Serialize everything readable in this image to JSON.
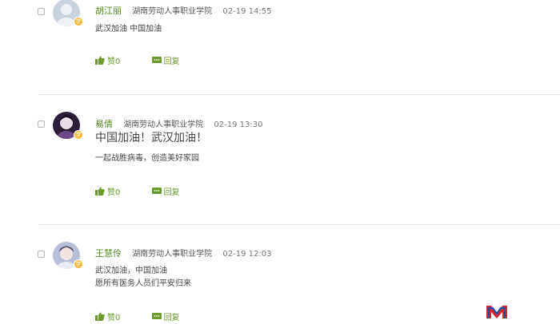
{
  "posts": [
    {
      "author": "胡江丽",
      "school": "湖南劳动人事职业学院",
      "time": "02-19 14:55",
      "lines": [
        "武汉加油 中国加油"
      ],
      "like_label": "赞0",
      "reply_label": "回复",
      "avatar_color": "#c8d3de"
    },
    {
      "author": "易倩",
      "school": "湖南劳动人事职业学院",
      "time": "02-19 13:30",
      "headline": "中国加油！武汉加油！",
      "lines": [
        "一起战胜病毒，创造美好家园"
      ],
      "like_label": "赞0",
      "reply_label": "回复",
      "avatar_color": "#2a1e38"
    },
    {
      "author": "王慧伶",
      "school": "湖南劳动人事职业学院",
      "time": "02-19 12:03",
      "lines": [
        "武汉加油，中国加油",
        "愿所有医务人员们平安归来"
      ],
      "like_label": "赞0",
      "reply_label": "回复",
      "avatar_color": "#b7bfd6"
    }
  ],
  "badge_glyph": "学",
  "colors": {
    "accent": "#6a9b2c",
    "name": "#55881e",
    "badge": "#f5b833"
  },
  "icons": {
    "like": "thumbs-up-icon",
    "reply": "comment-icon",
    "logo": "m-logo-icon"
  }
}
